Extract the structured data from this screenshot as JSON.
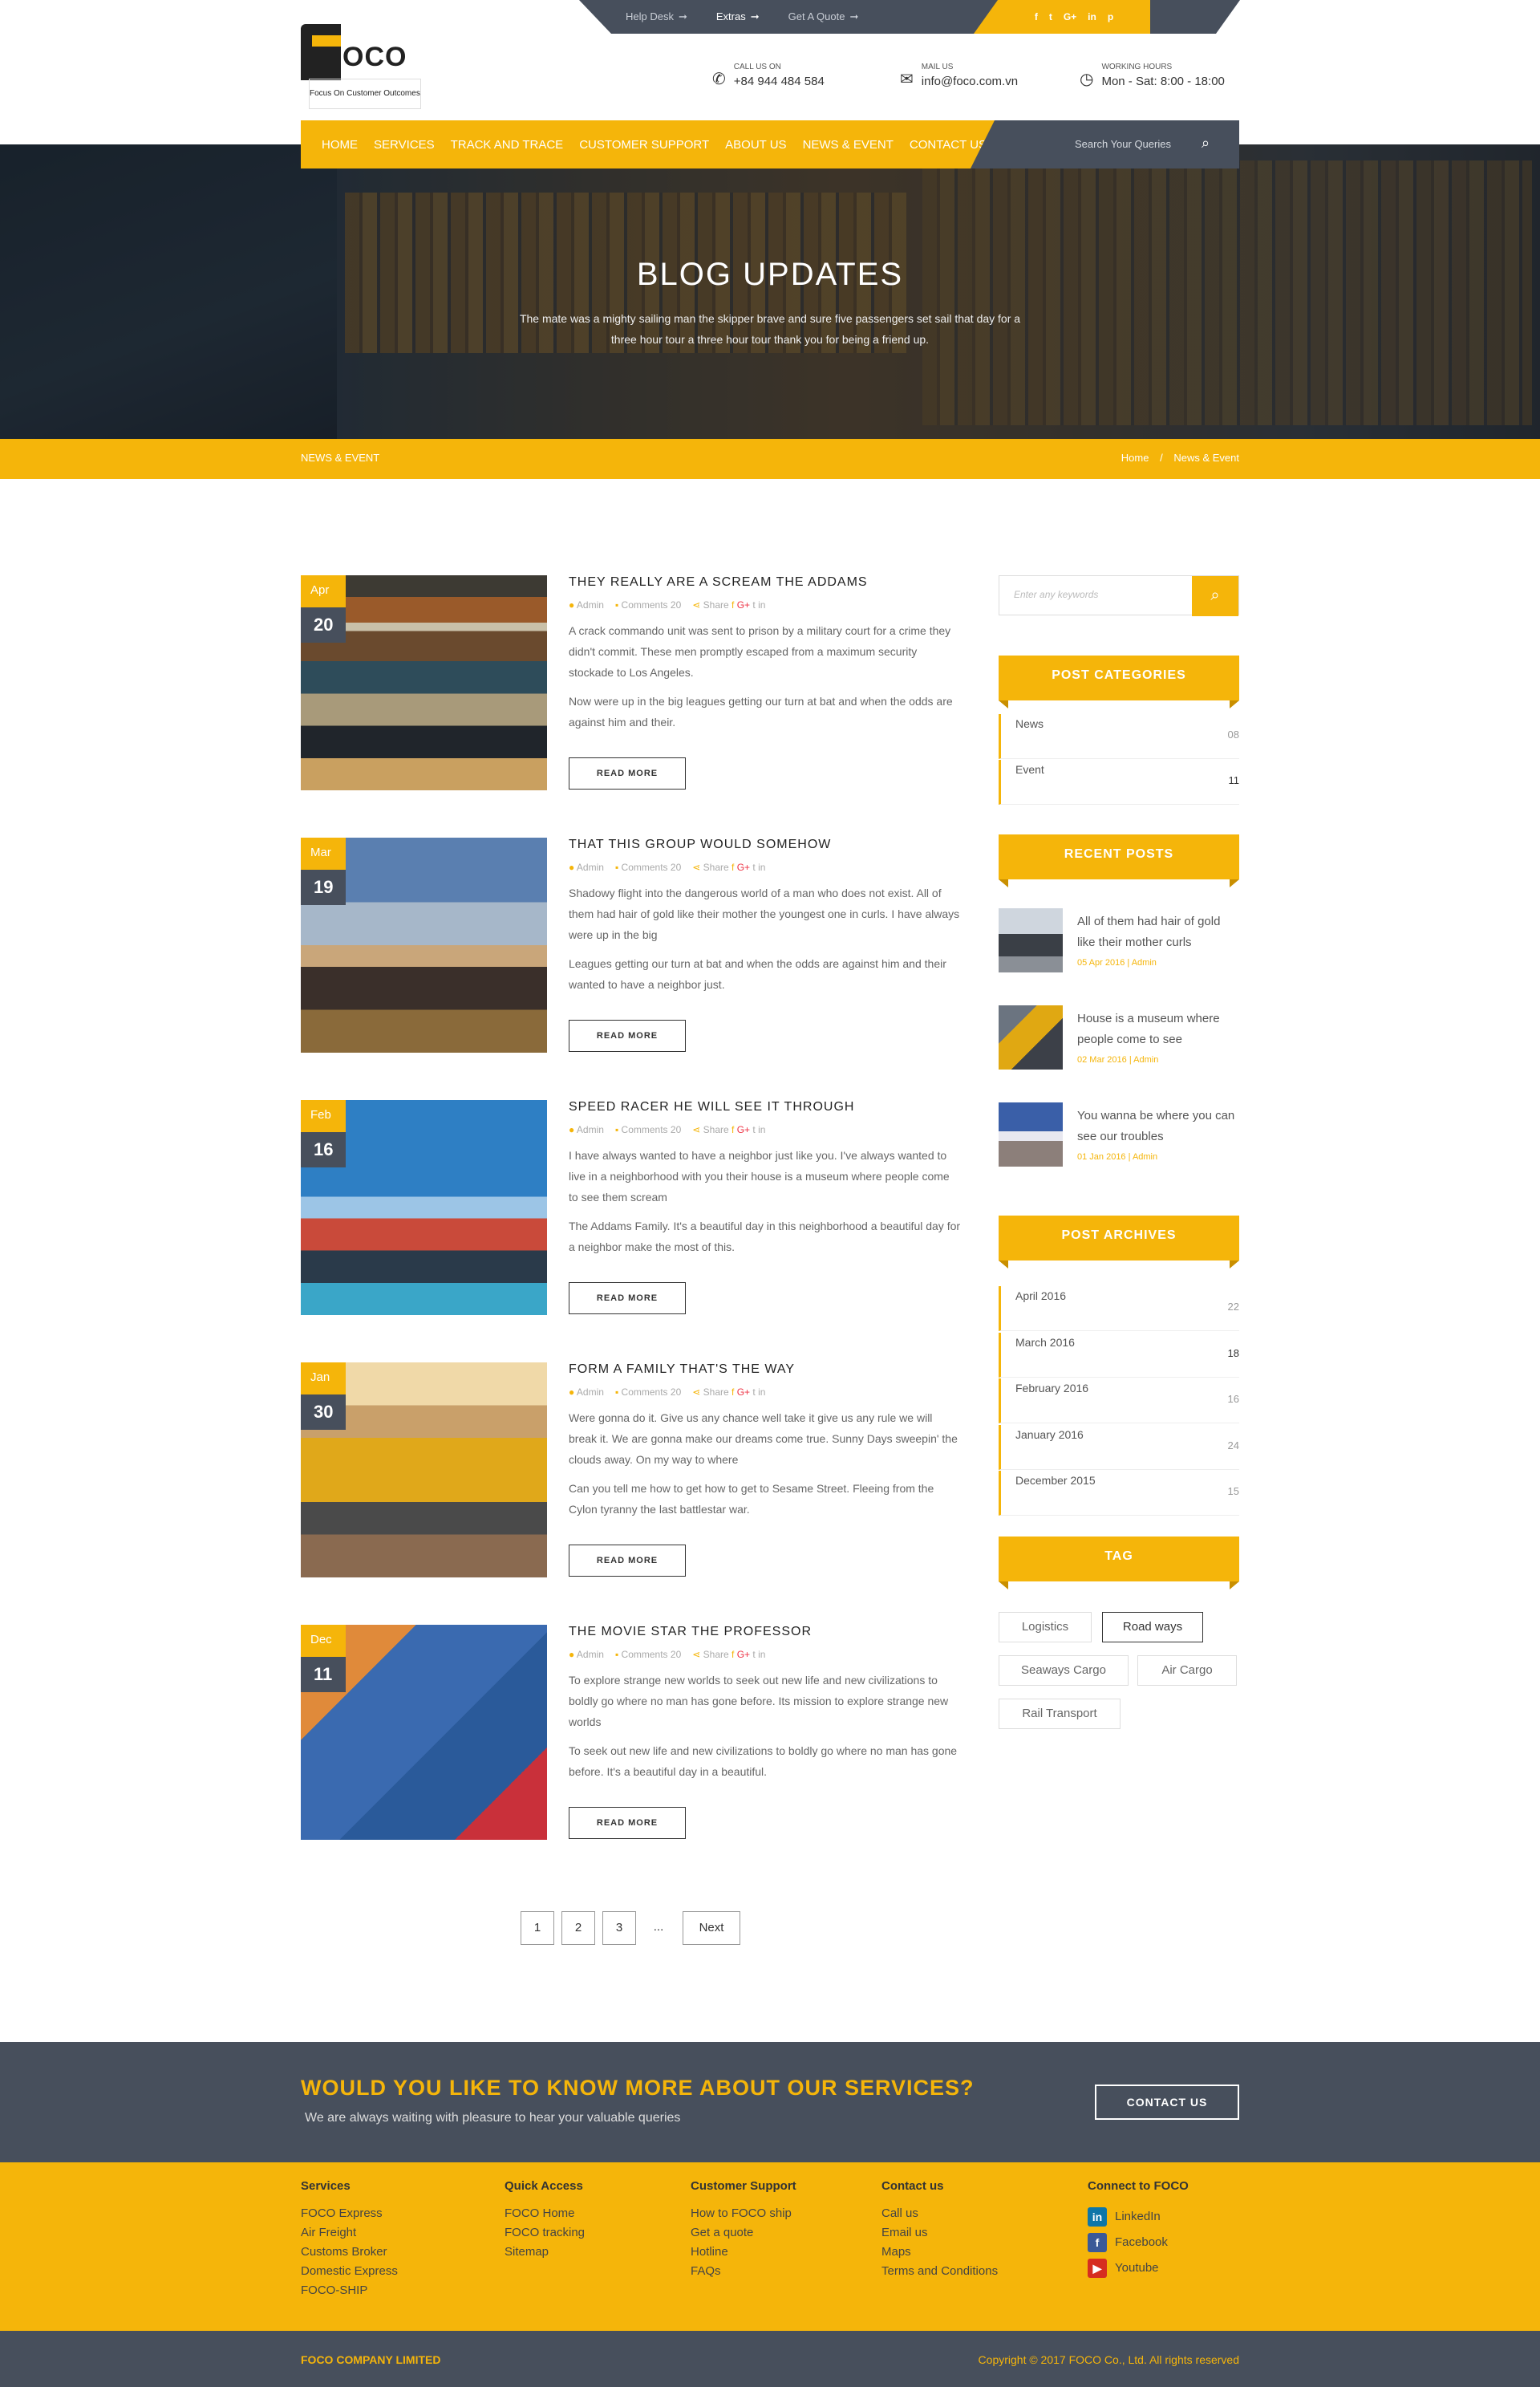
{
  "topbar": {
    "links": [
      {
        "label": "Help Desk"
      },
      {
        "label": "Extras"
      },
      {
        "label": "Get A Quote"
      }
    ],
    "social": [
      "f",
      "t",
      "G+",
      "in",
      "p"
    ]
  },
  "brand": {
    "logo_text": "OCO",
    "tagline": "Focus On Customer Outcomes"
  },
  "contact": {
    "call_label": "CALL US ON",
    "call_value": "+84 944 484 584",
    "mail_label": "MAIL US",
    "mail_value": "info@foco.com.vn",
    "hours_label": "WORKING HOURS",
    "hours_value": "Mon - Sat: 8:00 - 18:00"
  },
  "nav": {
    "items": [
      "HOME",
      "SERVICES",
      "TRACK AND TRACE",
      "CUSTOMER SUPPORT",
      "ABOUT US",
      "NEWS & EVENT",
      "CONTACT US"
    ],
    "search_placeholder": "Search Your Queries"
  },
  "hero": {
    "title": "BLOG UPDATES",
    "subtitle": "The mate was a mighty sailing man the skipper brave and sure five passengers set sail that day for a three hour tour a three hour tour thank you for being a friend up."
  },
  "breadcrumb": {
    "section": "NEWS & EVENT",
    "home": "Home",
    "sep": "/",
    "current": "News & Event"
  },
  "posts": [
    {
      "month": "Apr",
      "day": "20",
      "title": "THEY REALLY ARE A SCREAM THE ADDAMS",
      "author": "Admin",
      "comments": "Comments 20",
      "share": "Share",
      "p1": "A crack commando unit was sent to prison by a military court for a crime they didn't commit. These men promptly escaped from a maximum security stockade to Los Angeles.",
      "p2": "Now were up in the big leagues getting our turn at bat and when the odds are against him and their.",
      "btn": "READ MORE"
    },
    {
      "month": "Mar",
      "day": "19",
      "title": "THAT THIS GROUP WOULD SOMEHOW",
      "author": "Admin",
      "comments": "Comments 20",
      "share": "Share",
      "p1": "Shadowy flight into the dangerous world of a man who does not exist. All of them had hair of gold like their mother the youngest one in curls. I have always were up in the big",
      "p2": "Leagues getting our turn at bat and when the odds are against him and their wanted to have a neighbor just.",
      "btn": "READ MORE"
    },
    {
      "month": "Feb",
      "day": "16",
      "title": "SPEED RACER HE WILL SEE IT THROUGH",
      "author": "Admin",
      "comments": "Comments 20",
      "share": "Share",
      "p1": "I have always wanted to have a neighbor just like you. I've always wanted to live in a neighborhood with you their house is a museum where people come to see them scream",
      "p2": "The Addams Family. It's a beautiful day in this neighborhood a beautiful day for a neighbor make the most of this.",
      "btn": "READ MORE"
    },
    {
      "month": "Jan",
      "day": "30",
      "title": "FORM A FAMILY THAT'S THE WAY",
      "author": "Admin",
      "comments": "Comments 20",
      "share": "Share",
      "p1": "Were gonna do it. Give us any chance well take it give us any rule we will break it. We are gonna make our dreams come true. Sunny Days sweepin' the clouds away. On my way to where",
      "p2": "Can you tell me how to get how to get to Sesame Street. Fleeing from the Cylon tyranny the last battlestar war.",
      "btn": "READ MORE"
    },
    {
      "month": "Dec",
      "day": "11",
      "title": "THE MOVIE STAR THE PROFESSOR",
      "author": "Admin",
      "comments": "Comments 20",
      "share": "Share",
      "p1": "To explore strange new worlds to seek out new life and new civilizations to boldly go where no man has gone before. Its mission to explore strange new worlds",
      "p2": "To seek out new life and new civilizations to boldly go where no man has gone before. It's a beautiful day in a beautiful.",
      "btn": "READ MORE"
    }
  ],
  "sidebar": {
    "search_placeholder": "Enter any keywords",
    "categories_title": "POST CATEGORIES",
    "categories": [
      {
        "name": "News",
        "count": "08"
      },
      {
        "name": "Event",
        "count": "11"
      }
    ],
    "recent_title": "RECENT POSTS",
    "recent": [
      {
        "title": "All of them had hair of gold like their mother curls",
        "date": "05 Apr 2016",
        "author": "Admin"
      },
      {
        "title": "House is a museum where people come to see",
        "date": "02 Mar 2016",
        "author": "Admin"
      },
      {
        "title": "You wanna be where you can see our troubles",
        "date": "01 Jan 2016",
        "author": "Admin"
      }
    ],
    "archives_title": "POST ARCHIVES",
    "archives": [
      {
        "name": "April 2016",
        "count": "22"
      },
      {
        "name": "March 2016",
        "count": "18"
      },
      {
        "name": "February 2016",
        "count": "16"
      },
      {
        "name": "January 2016",
        "count": "24"
      },
      {
        "name": "December 2015",
        "count": "15"
      }
    ],
    "tag_title": "TAG",
    "tags": [
      "Logistics",
      "Road ways",
      "Seaways Cargo",
      "Air Cargo",
      "Rail Transport"
    ]
  },
  "pagination": {
    "pages": [
      "1",
      "2",
      "3"
    ],
    "ellipsis": "...",
    "next": "Next"
  },
  "cta": {
    "title": "WOULD YOU LIKE TO KNOW MORE ABOUT OUR SERVICES?",
    "subtitle": "We are always waiting with pleasure to hear your valuable queries",
    "btn": "CONTACT US"
  },
  "footer": {
    "services": {
      "title": "Services",
      "items": [
        "FOCO Express",
        "Air Freight",
        "Customs Broker",
        "Domestic Express",
        "FOCO-SHIP"
      ]
    },
    "quick": {
      "title": "Quick Access",
      "items": [
        "FOCO Home",
        "FOCO tracking",
        "Sitemap"
      ]
    },
    "support": {
      "title": "Customer Support",
      "items": [
        "How to FOCO ship",
        "Get a quote",
        "Hotline",
        "FAQs"
      ]
    },
    "contact": {
      "title": "Contact us",
      "items": [
        "Call us",
        "Email us",
        "Maps",
        "Terms and Conditions"
      ]
    },
    "connect": {
      "title": "Connect to FOCO",
      "items": [
        "LinkedIn",
        "Facebook",
        "Youtube"
      ]
    },
    "company": "FOCO COMPANY LIMITED",
    "copyright": "Copyright © 2017 FOCO Co., Ltd. All rights reserved"
  },
  "colors": {
    "accent": "#f5b50a",
    "dark": "#474f5c"
  }
}
